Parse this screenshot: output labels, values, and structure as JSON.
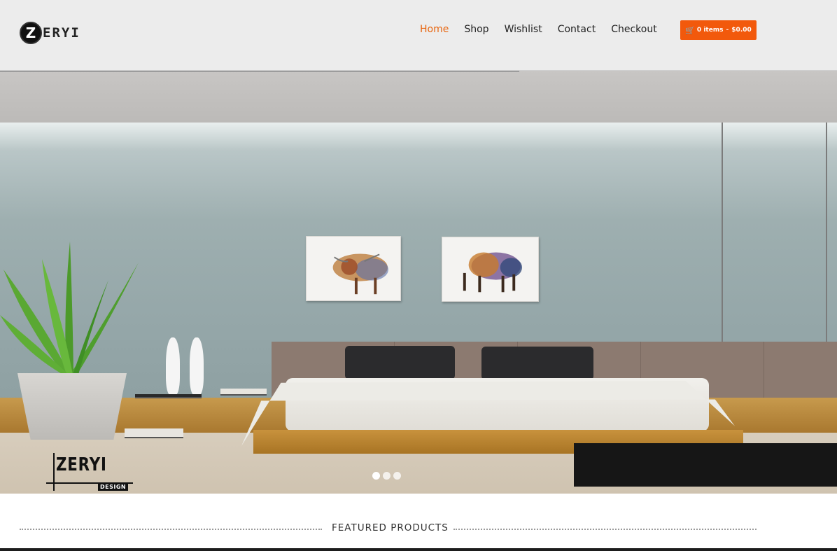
{
  "header": {
    "logo_letter": "Z",
    "logo_text": "ERYI",
    "nav": [
      {
        "label": "Home",
        "active": true
      },
      {
        "label": "Shop",
        "active": false
      },
      {
        "label": "Wishlist",
        "active": false
      },
      {
        "label": "Contact",
        "active": false
      },
      {
        "label": "Checkout",
        "active": false
      }
    ],
    "cart": {
      "icon": "cart-icon",
      "items_label": "0 items",
      "separator": "-",
      "total": "$0.00"
    }
  },
  "hero": {
    "slide_progress": 0.62,
    "brand_word": "ZERYI",
    "brand_sub": "DESIGN",
    "slides": 3,
    "active_slide": 1
  },
  "featured": {
    "title": "FEATURED PRODUCTS"
  },
  "colors": {
    "accent": "#f2590c",
    "nav_active": "#e8650f",
    "header_bg": "#ececec"
  }
}
